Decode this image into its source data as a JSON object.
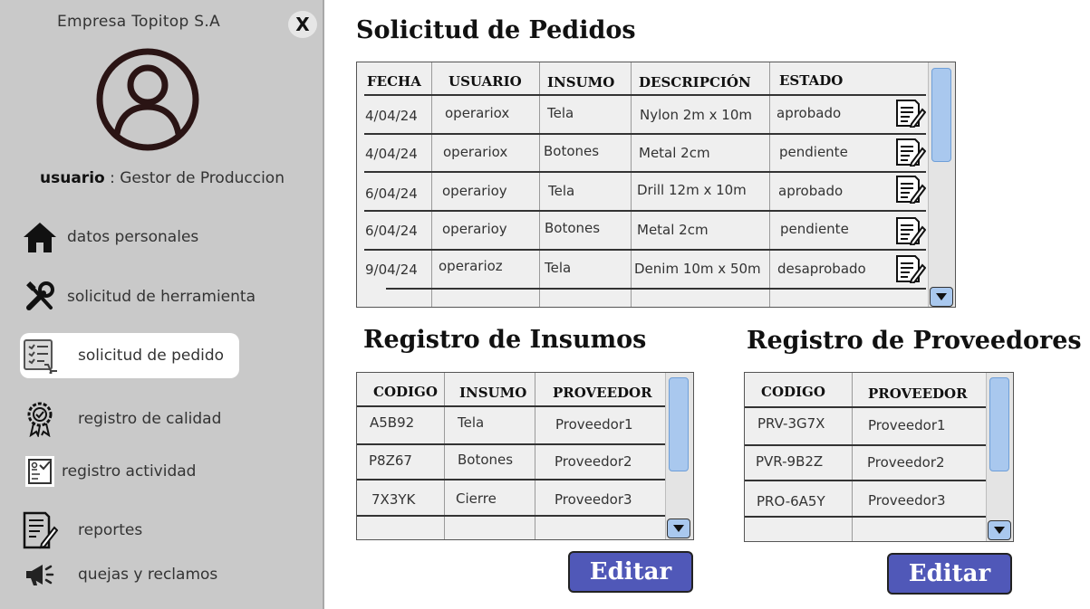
{
  "sidebar": {
    "company": "Empresa Topitop S.A",
    "close_label": "X",
    "user_label": "usuario",
    "user_separator": " : ",
    "user_role": "Gestor de Produccion",
    "items": [
      {
        "label": "datos personales",
        "icon": "home-icon"
      },
      {
        "label": "solicitud de herramienta",
        "icon": "tools-icon"
      },
      {
        "label": "solicitud de pedido",
        "icon": "order-list-icon",
        "active": true
      },
      {
        "label": "registro de calidad",
        "icon": "quality-badge-icon"
      },
      {
        "label": "registro actividad",
        "icon": "activity-form-icon"
      },
      {
        "label": "reportes",
        "icon": "report-edit-icon"
      },
      {
        "label": "quejas y reclamos",
        "icon": "megaphone-icon"
      }
    ]
  },
  "pedidos": {
    "title": "Solicitud de Pedidos",
    "headers": [
      "FECHA",
      "USUARIO",
      "INSUMO",
      "DESCRIPCIÓN",
      "ESTADO"
    ],
    "rows": [
      [
        "4/04/24",
        "operariox",
        "Tela",
        "Nylon 2m x 10m",
        "aprobado"
      ],
      [
        "4/04/24",
        "operariox",
        "Botones",
        "Metal 2cm",
        "pendiente"
      ],
      [
        "6/04/24",
        "operarioy",
        "Tela",
        "Drill 12m x 10m",
        "aprobado"
      ],
      [
        "6/04/24",
        "operarioy",
        "Botones",
        "Metal 2cm",
        "pendiente"
      ],
      [
        "9/04/24",
        "operarioz",
        "Tela",
        "Denim 10m x 50m",
        "desaprobado"
      ]
    ]
  },
  "insumos": {
    "title": "Registro de Insumos",
    "headers": [
      "CODIGO",
      "INSUMO",
      "PROVEEDOR"
    ],
    "rows": [
      [
        "A5B92",
        "Tela",
        "Proveedor1"
      ],
      [
        "P8Z67",
        "Botones",
        "Proveedor2"
      ],
      [
        "7X3YK",
        "Cierre",
        "Proveedor3"
      ]
    ],
    "edit_label": "Editar"
  },
  "proveedores": {
    "title": "Registro de Proveedores",
    "headers": [
      "CODIGO",
      "PROVEEDOR"
    ],
    "rows": [
      [
        "PRV-3G7X",
        "Proveedor1"
      ],
      [
        "PVR-9B2Z",
        "Proveedor2"
      ],
      [
        "PRO-6A5Y",
        "Proveedor3"
      ]
    ],
    "edit_label": "Editar"
  },
  "colors": {
    "sidebar_bg": "#c9c9c9",
    "edit_button": "#5058b8",
    "scroll_accent": "#a9c8ee"
  }
}
